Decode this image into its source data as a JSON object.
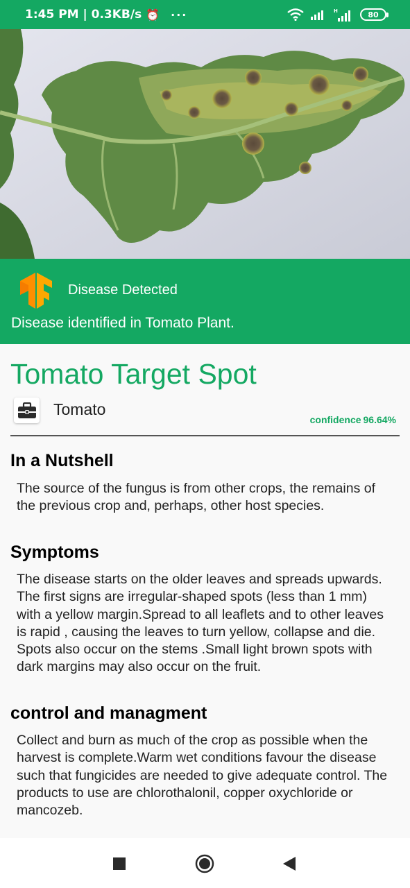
{
  "status_bar": {
    "time_speed": "1:45 PM | 0.3KB/s",
    "alarm_icon": "alarm-clock-icon",
    "more": "···",
    "battery": "80"
  },
  "hero": {
    "image": "tomato-leaf-photo"
  },
  "banner": {
    "title": "Disease Detected",
    "subtitle": "Disease identified in Tomato Plant.",
    "color": "#14a862"
  },
  "result": {
    "disease_name": "Tomato Target Spot",
    "crop_icon": "briefcase-icon",
    "crop": "Tomato",
    "confidence_label": "confidence",
    "confidence_value": "96.64%"
  },
  "sections": [
    {
      "heading": "In a Nutshell",
      "body": "The source of the fungus is from other crops, the remains of the previous crop and, perhaps, other host species."
    },
    {
      "heading": "Symptoms",
      "body": "The disease starts on the older leaves and spreads upwards. The first signs are irregular-shaped spots (less than 1 mm) with a yellow margin.Spread to all leaflets and to other leaves is rapid , causing the leaves to turn yellow, collapse and die. Spots also occur on the stems .Small light brown spots with dark margins may also occur on the fruit."
    },
    {
      "heading": "control and managment",
      "body": "Collect and burn as much of the crop as possible when the harvest is complete.Warm wet conditions favour the disease such that fungicides are needed to give adequate control. The products to use are chlorothalonil, copper oxychloride or mancozeb."
    }
  ],
  "nav_bar": {
    "recents_icon": "square-recents-icon",
    "home_icon": "circle-home-icon",
    "back_icon": "triangle-back-icon"
  }
}
